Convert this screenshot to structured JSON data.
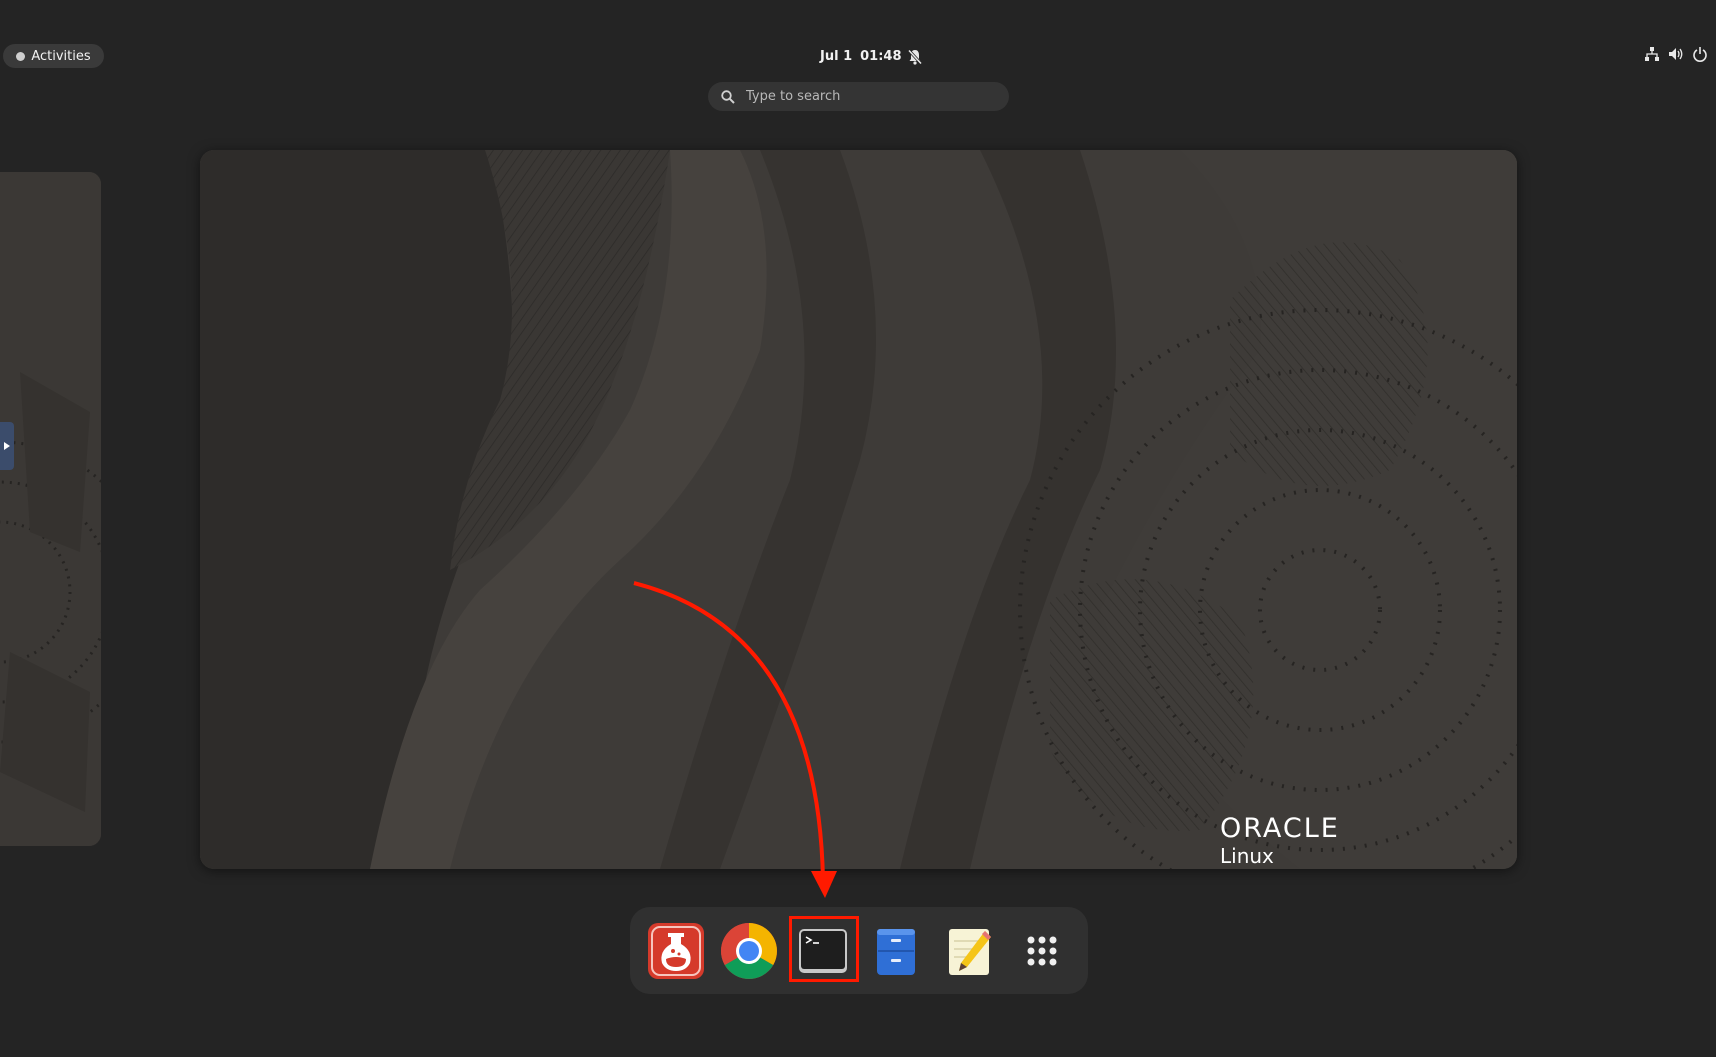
{
  "top_bar": {
    "activities_label": "Activities",
    "date": "Jul 1",
    "time": "01:48",
    "bell_icon": "notifications-disabled-icon",
    "tray_icons": [
      "network-icon",
      "volume-icon",
      "power-icon"
    ]
  },
  "search": {
    "placeholder": "Type to search"
  },
  "workspace": {
    "wallpaper_brand": "ORACLE",
    "wallpaper_sub": "Linux"
  },
  "dock": {
    "items": [
      {
        "name": "lab-flask-app",
        "icon": "lab-flask-icon"
      },
      {
        "name": "google-chrome",
        "icon": "chrome-icon"
      },
      {
        "name": "terminal",
        "icon": "terminal-icon",
        "highlighted": true
      },
      {
        "name": "files",
        "icon": "file-cabinet-icon"
      },
      {
        "name": "text-editor",
        "icon": "text-editor-icon"
      },
      {
        "name": "show-applications",
        "icon": "app-grid-icon"
      }
    ]
  },
  "colors": {
    "background": "#242424",
    "annotation": "#ff1a00",
    "dock": "#303030"
  }
}
